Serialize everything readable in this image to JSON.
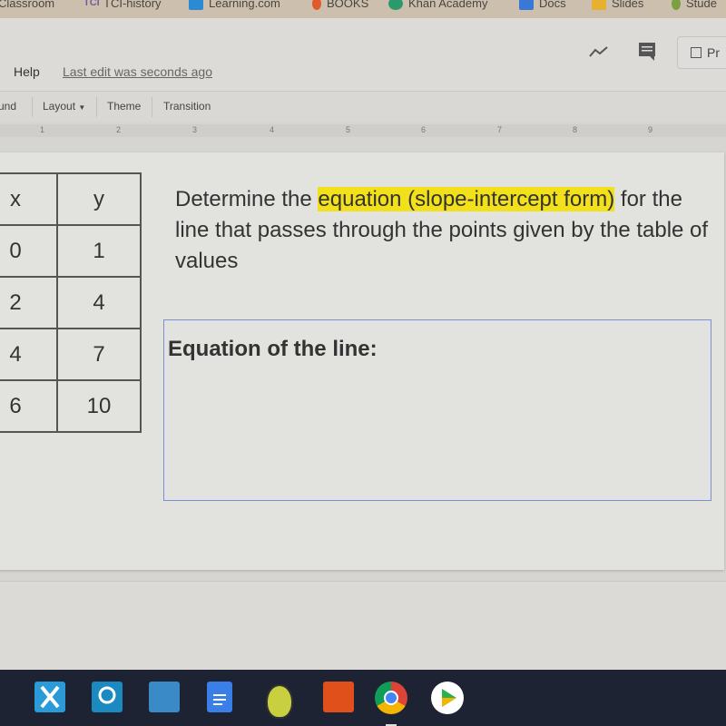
{
  "bookmarks": [
    {
      "label": "Classroom",
      "color": "#cdbfae"
    },
    {
      "label": "TCI-history",
      "color": "#7a5a9a"
    },
    {
      "label": "Learning.com",
      "color": "#2a8ad4"
    },
    {
      "label": "BOOKS",
      "color": "#e05a2a"
    },
    {
      "label": "Khan Academy",
      "color": "#2a9a6a"
    },
    {
      "label": "Docs",
      "color": "#3a78d8"
    },
    {
      "label": "Slides",
      "color": "#e8b030"
    },
    {
      "label": "Stude",
      "color": "#7aa040"
    }
  ],
  "menu": {
    "help": "Help",
    "last_edit": "Last edit was seconds ago",
    "present": "Pr"
  },
  "toolbar": {
    "background": "und",
    "layout": "Layout",
    "theme": "Theme",
    "transition": "Transition"
  },
  "ruler": [
    "1",
    "2",
    "3",
    "4",
    "5",
    "6",
    "7",
    "8",
    "9"
  ],
  "table": {
    "headers": [
      "x",
      "y"
    ],
    "rows": [
      [
        "0",
        "1"
      ],
      [
        "2",
        "4"
      ],
      [
        "4",
        "7"
      ],
      [
        "6",
        "10"
      ]
    ]
  },
  "prompt": {
    "before": "Determine the ",
    "highlight": "equation (slope-intercept form)",
    "after": " for the line that passes through the points given by the table of values",
    "highlight_color": "#f2e11a"
  },
  "answer_box": {
    "label": "Equation of the line:"
  },
  "taskbar": [
    {
      "icon": "explain-everything-icon",
      "color": "#2a9ad8"
    },
    {
      "icon": "edpuzzle-icon",
      "color": "#1a8ac0"
    },
    {
      "icon": "scratch-app-icon",
      "color": "#3a8ac8"
    },
    {
      "icon": "google-docs-icon",
      "color": "#3a7ee8"
    },
    {
      "icon": "pear-deck-icon",
      "color": "#c8d040"
    },
    {
      "icon": "vitruvian-app-icon",
      "color": "#e0501a"
    },
    {
      "icon": "chrome-icon",
      "color": "#db4437"
    },
    {
      "icon": "play-store-icon",
      "color": "#ffffff"
    }
  ]
}
